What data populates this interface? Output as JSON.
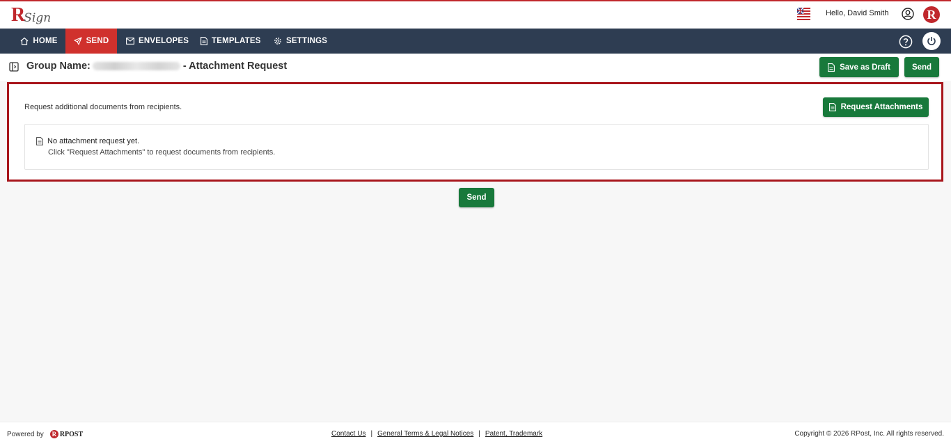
{
  "header": {
    "logo_letter": "R",
    "logo_text": "Sign",
    "greeting": "Hello, David Smith",
    "flag_icon": "us-uk-flag-icon",
    "brand_badge": "R"
  },
  "nav": {
    "items": [
      {
        "label": "HOME",
        "icon": "home-icon"
      },
      {
        "label": "SEND",
        "icon": "paper-plane-icon"
      },
      {
        "label": "ENVELOPES",
        "icon": "envelope-icon"
      },
      {
        "label": "TEMPLATES",
        "icon": "document-icon"
      },
      {
        "label": "SETTINGS",
        "icon": "gear-icon"
      }
    ],
    "active": "SEND",
    "accent_color": "#d0312d",
    "bar_color": "#2e3d52"
  },
  "subheader": {
    "group_label": "Group Name:",
    "title_suffix": "- Attachment Request",
    "save_draft_label": "Save as Draft",
    "send_label": "Send"
  },
  "main": {
    "description": "Request additional documents from recipients.",
    "request_button_label": "Request Attachments",
    "empty_title": "No attachment request yet.",
    "empty_subtitle": "Click \"Request Attachments\" to request documents from recipients.",
    "send_label": "Send"
  },
  "footer": {
    "powered_by": "Powered by",
    "rpost_logo_text": "RPOST",
    "links": [
      "Contact Us",
      "General Terms & Legal Notices",
      "Patent, Trademark"
    ],
    "copyright": "Copyright © 2026 RPost, Inc. All rights reserved."
  },
  "colors": {
    "primary_green": "#18793b",
    "brand_red": "#c0282d",
    "highlight_border": "#a8161c"
  }
}
